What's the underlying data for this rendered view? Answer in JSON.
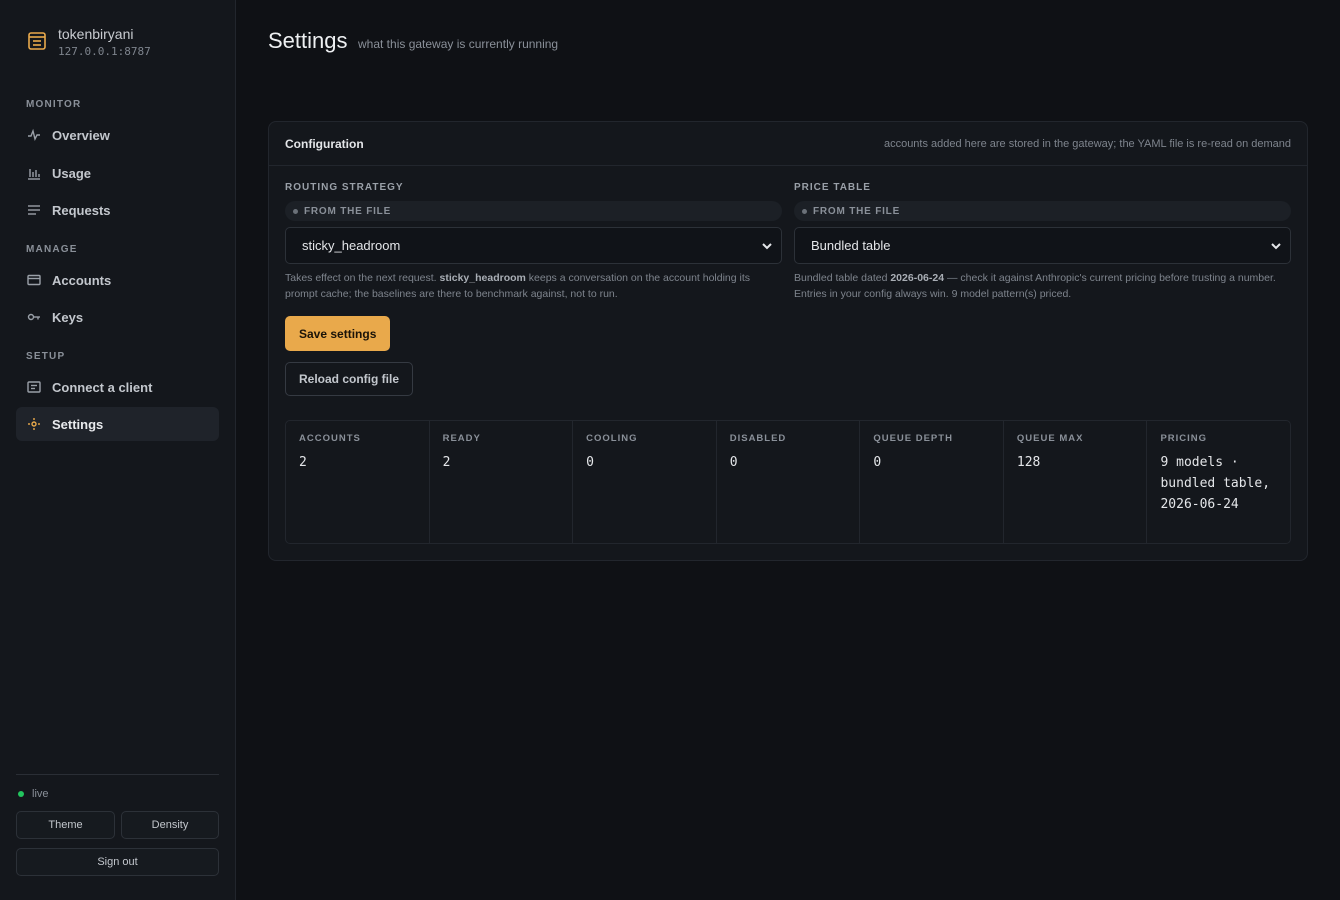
{
  "brand": {
    "name": "tokenbiryani",
    "address": "127.0.0.1:8787",
    "icon": "box-logo-icon"
  },
  "sidebar": {
    "sections": {
      "monitor": "MONITOR",
      "manage": "MANAGE",
      "setup": "SETUP"
    },
    "items": [
      {
        "label": "Overview",
        "icon": "activity-icon"
      },
      {
        "label": "Usage",
        "icon": "bar-chart-icon"
      },
      {
        "label": "Requests",
        "icon": "list-icon"
      },
      {
        "label": "Accounts",
        "icon": "card-icon"
      },
      {
        "label": "Keys",
        "icon": "key-icon"
      },
      {
        "label": "Connect a client",
        "icon": "terminal-icon"
      },
      {
        "label": "Settings",
        "icon": "gear-icon",
        "active": true
      }
    ],
    "status": "live",
    "theme_label": "Theme",
    "density_label": "Density",
    "signout_label": "Sign out"
  },
  "page": {
    "title": "Settings",
    "subtitle": "what this gateway is currently running"
  },
  "config": {
    "title": "Configuration",
    "note": "accounts added here are stored in the gateway; the YAML file is re-read on demand",
    "routing": {
      "label": "ROUTING STRATEGY",
      "source": "FROM THE FILE",
      "value": "sticky_headroom",
      "help_pre": "Takes effect on the next request. ",
      "help_strong": "sticky_headroom",
      "help_post": " keeps a conversation on the account holding its prompt cache; the baselines are there to benchmark against, not to run."
    },
    "price": {
      "label": "PRICE TABLE",
      "source": "FROM THE FILE",
      "value": "Bundled table",
      "help_pre": "Bundled table dated ",
      "help_strong": "2026-06-24",
      "help_post": " — check it against Anthropic's current pricing before trusting a number. Entries in your config always win. 9 model pattern(s) priced."
    },
    "save_label": "Save settings",
    "reload_label": "Reload config file"
  },
  "stats": [
    {
      "label": "ACCOUNTS",
      "value": "2"
    },
    {
      "label": "READY",
      "value": "2"
    },
    {
      "label": "COOLING",
      "value": "0"
    },
    {
      "label": "DISABLED",
      "value": "0"
    },
    {
      "label": "QUEUE DEPTH",
      "value": "0"
    },
    {
      "label": "QUEUE MAX",
      "value": "128"
    },
    {
      "label": "PRICING",
      "value": "9 models · bundled table, 2026-06-24"
    }
  ],
  "colors": {
    "accent": "#e9a94b",
    "live": "#22c55e",
    "background": "#0f1115",
    "sidebar": "#14171c"
  }
}
